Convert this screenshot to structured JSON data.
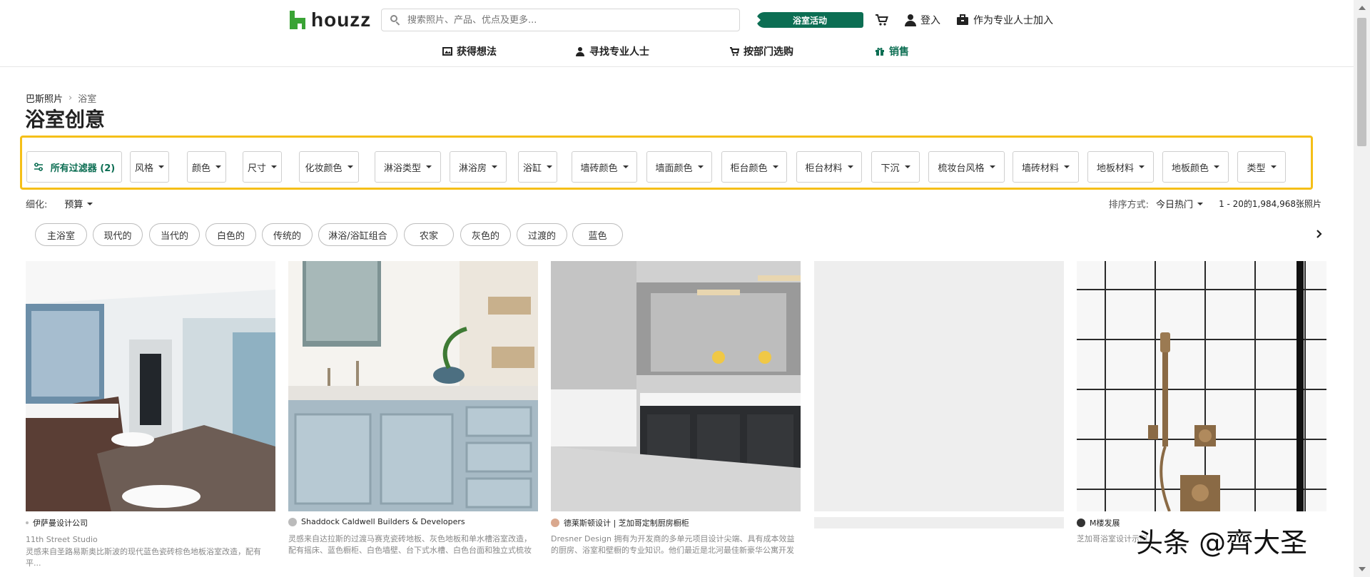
{
  "brand": {
    "name": "houzz",
    "color": "#3aa335"
  },
  "header": {
    "search_placeholder": "搜索照片、产品、优点及更多...",
    "promo": "浴室活动",
    "login": "登入",
    "join_pro": "作为专业人士加入"
  },
  "nav": {
    "items": [
      {
        "label": "获得想法",
        "icon": "photos-icon"
      },
      {
        "label": "寻找专业人士",
        "icon": "pro-icon"
      },
      {
        "label": "按部门选购",
        "icon": "cart-icon"
      },
      {
        "label": "销售",
        "icon": "gift-icon"
      }
    ],
    "sale_color": "#0c6e53"
  },
  "breadcrumb": {
    "parent": "巴斯照片",
    "current": "浴室"
  },
  "page_title": "浴室创意",
  "filters": {
    "all_label": "所有过滤器 (2)",
    "items": [
      "风格",
      "颜色",
      "尺寸",
      "化妆颜色",
      "淋浴类型",
      "淋浴房",
      "浴缸",
      "墙砖颜色",
      "墙面颜色",
      "柜台颜色",
      "柜台材料",
      "下沉",
      "梳妆台风格",
      "墙砖材料",
      "地板材料",
      "地板颜色",
      "类型"
    ],
    "highlight_color": "#f5bf18"
  },
  "refine": {
    "label": "细化:",
    "budget": "预算"
  },
  "sort": {
    "label": "排序方式:",
    "value": "今日热门",
    "count": "1 - 20的1,984,968张照片"
  },
  "chips": [
    "主浴室",
    "现代的",
    "当代的",
    "白色的",
    "传统的",
    "淋浴/浴缸组合",
    "农家",
    "灰色的",
    "过渡的",
    "蓝色"
  ],
  "cards": [
    {
      "pro": "伊萨曼设计公司",
      "sub": "11th Street Studio",
      "desc": "灵感来自圣路易斯奥比斯波的现代蓝色瓷砖棕色地板浴室改造，配有平..."
    },
    {
      "pro": "Shaddock Caldwell Builders & Developers",
      "sub": "",
      "desc": "灵感来自达拉斯的过渡马赛克瓷砖地板、灰色地板和单水槽浴室改造，配有摇床、蓝色橱柜、白色墙壁、台下式水槽、白色台面和独立式梳妆台"
    },
    {
      "pro": "德莱斯顿设计 | 芝加哥定制厨房橱柜",
      "sub": "",
      "desc": "Dresner Design 拥有为开发商的多单元项目设计尖端、具有成本效益的厨房、浴室和壁橱的专业知识。他们最近是北河最佳新豪华公寓开发项目..."
    },
    {
      "pro": "",
      "sub": "",
      "desc": ""
    },
    {
      "pro": "M楼发展",
      "sub": "",
      "desc": "芝加哥浴室设计示例"
    }
  ],
  "watermark": "头条 @齊大圣"
}
